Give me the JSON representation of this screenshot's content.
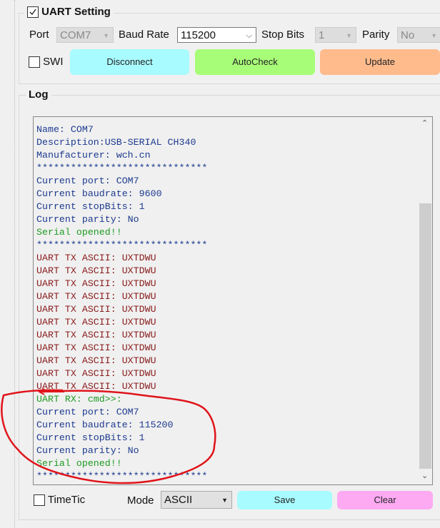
{
  "uart": {
    "title": "UART Setting",
    "checked": true,
    "port_label": "Port",
    "port_value": "COM7",
    "baud_label": "Baud Rate",
    "baud_value": "115200",
    "stop_label": "Stop Bits",
    "stop_value": "1",
    "parity_label": "Parity",
    "parity_value": "No",
    "sw_label": "SWI",
    "buttons": {
      "disconnect": "Disconnect",
      "autocheck": "AutoCheck",
      "update": "Update"
    }
  },
  "colors": {
    "disconnect": "#a8fbff",
    "autocheck": "#a8fd78",
    "update": "#ffbb8c",
    "save": "#a8fbff",
    "clear": "#fdaaf3",
    "annotation": "#e0141a"
  },
  "log": {
    "title": "Log",
    "lines": [
      {
        "text": "Name: COM7",
        "color": "blue"
      },
      {
        "text": "Description:USB-SERIAL CH340",
        "color": "blue"
      },
      {
        "text": "Manufacturer: wch.cn",
        "color": "blue"
      },
      {
        "text": "******************************",
        "color": "blue"
      },
      {
        "text": "Current port: COM7",
        "color": "blue"
      },
      {
        "text": "Current baudrate: 9600",
        "color": "blue"
      },
      {
        "text": "Current stopBits: 1",
        "color": "blue"
      },
      {
        "text": "Current parity: No",
        "color": "blue"
      },
      {
        "text": "Serial opened!!",
        "color": "green"
      },
      {
        "text": "******************************",
        "color": "blue"
      },
      {
        "text": "UART TX ASCII: UXTDWU",
        "color": "red"
      },
      {
        "text": "UART TX ASCII: UXTDWU",
        "color": "red"
      },
      {
        "text": "UART TX ASCII: UXTDWU",
        "color": "red"
      },
      {
        "text": "UART TX ASCII: UXTDWU",
        "color": "red"
      },
      {
        "text": "UART TX ASCII: UXTDWU",
        "color": "red"
      },
      {
        "text": "UART TX ASCII: UXTDWU",
        "color": "red"
      },
      {
        "text": "UART TX ASCII: UXTDWU",
        "color": "red"
      },
      {
        "text": "UART TX ASCII: UXTDWU",
        "color": "red"
      },
      {
        "text": "UART TX ASCII: UXTDWU",
        "color": "red"
      },
      {
        "text": "UART TX ASCII: UXTDWU",
        "color": "red"
      },
      {
        "text": "UART TX ASCII: UXTDWU",
        "color": "red"
      },
      {
        "text": "UART RX: cmd>>:",
        "color": "green"
      },
      {
        "text": "Current port: COM7",
        "color": "blue"
      },
      {
        "text": "Current baudrate: 115200",
        "color": "blue"
      },
      {
        "text": "Current stopBits: 1",
        "color": "blue"
      },
      {
        "text": "Current parity: No",
        "color": "blue"
      },
      {
        "text": "Serial opened!!",
        "color": "green"
      },
      {
        "text": "******************************",
        "color": "blue"
      }
    ],
    "timetic_label": "TimeTic",
    "mode_label": "Mode",
    "mode_value": "ASCII",
    "save": "Save",
    "clear": "Clear"
  }
}
